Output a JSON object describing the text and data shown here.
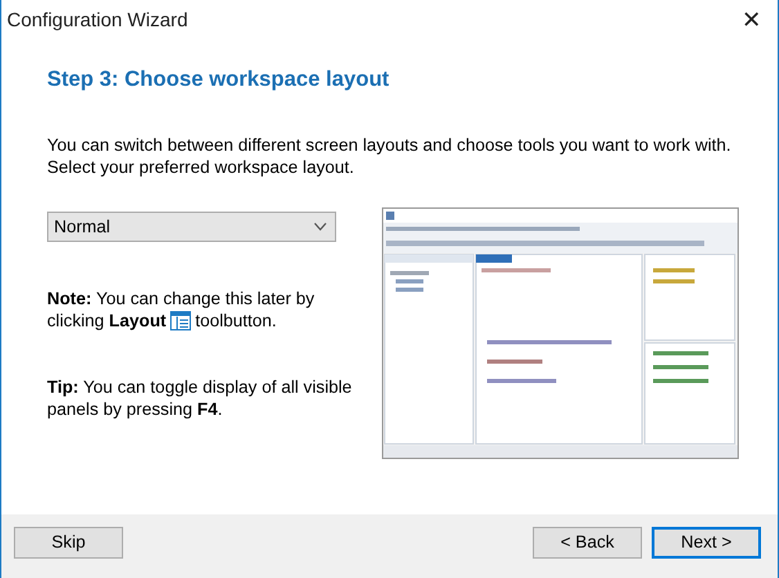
{
  "window": {
    "title": "Configuration Wizard",
    "close": "✕"
  },
  "heading": "Step 3: Choose workspace layout",
  "intro": [
    "You can switch between different screen layouts and choose tools you want to work with.",
    "Select your preferred workspace layout."
  ],
  "layout_dropdown": {
    "value": "Normal"
  },
  "note": {
    "line1": "**Note:** You can change this later by",
    "before": "clicking **Layout**",
    "after": "toolbutton."
  },
  "tip": "**Tip:** You can toggle display of all visible panels by pressing **F4**.",
  "buttons": [
    {
      "label": "Skip",
      "default": false
    },
    {
      "label": "< Back",
      "default": false
    },
    {
      "label": "Next >",
      "default": true
    }
  ]
}
